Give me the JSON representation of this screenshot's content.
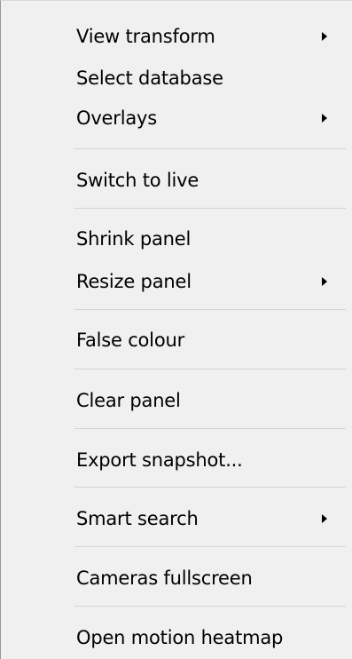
{
  "menu": {
    "items": [
      {
        "label": "View transform",
        "submenu": true
      },
      {
        "label": "Select database",
        "submenu": false
      },
      {
        "label": "Overlays",
        "submenu": true
      },
      {
        "label": "Switch to live",
        "submenu": false
      },
      {
        "label": "Shrink panel",
        "submenu": false
      },
      {
        "label": "Resize panel",
        "submenu": true
      },
      {
        "label": "False colour",
        "submenu": false
      },
      {
        "label": "Clear panel",
        "submenu": false
      },
      {
        "label": "Export snapshot...",
        "submenu": false
      },
      {
        "label": "Smart search",
        "submenu": true
      },
      {
        "label": "Cameras fullscreen",
        "submenu": false
      },
      {
        "label": "Open motion heatmap",
        "submenu": false
      }
    ],
    "submenu_arrow_icon": "triangle-right-icon",
    "colors": {
      "background": "#f0f0f0",
      "text": "#000000",
      "separator": "#d4d4d4"
    }
  }
}
